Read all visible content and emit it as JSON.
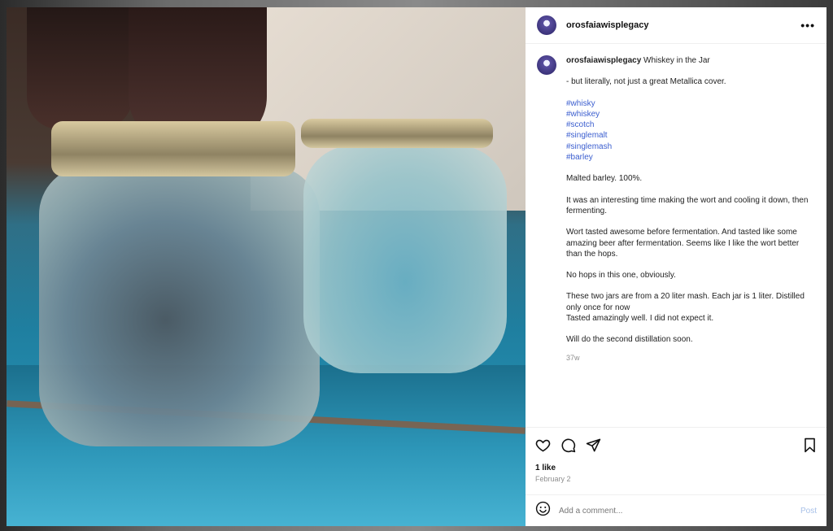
{
  "post": {
    "username": "orosfaiawisplegacy",
    "title": "Whiskey in the Jar",
    "more_label": "•••",
    "paragraph1": "- but literally, not just a great Metallica cover.",
    "hashtags": [
      "#whisky",
      "#whiskey",
      "#scotch",
      "#singlemalt",
      "#singlemash",
      "#barley"
    ],
    "paragraph2": "Malted barley. 100%.",
    "paragraph3": "It was an interesting time making the wort and cooling it down, then fermenting.",
    "paragraph4": "Wort tasted awesome before fermentation. And tasted like some amazing beer after fermentation. Seems like I like the wort better than the hops.",
    "paragraph5": "No hops in this one, obviously.",
    "paragraph6a": "These two jars are from a 20 liter mash. Each jar is 1 liter. Distilled only once for now",
    "paragraph6b": "Tasted amazingly well. I did not expect it.",
    "paragraph7": "Will do the second distillation soon.",
    "age": "37w",
    "likes": "1 like",
    "date": "February 2"
  },
  "icons": {
    "like": "heart-icon",
    "comment": "comment-icon",
    "share": "share-icon",
    "save": "bookmark-icon",
    "emoji": "emoji-icon"
  },
  "comment_box": {
    "placeholder": "Add a comment...",
    "post_label": "Post"
  },
  "colors": {
    "hashtag": "#3b5ecf",
    "post_disabled": "#a8c1e8"
  }
}
